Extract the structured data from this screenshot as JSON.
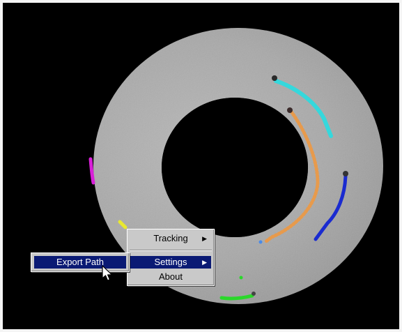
{
  "menu": {
    "tracking_label": "Tracking",
    "settings_label": "Settings",
    "about_label": "About",
    "submenu_arrow": "▶"
  },
  "submenu": {
    "export_path_label": "Export Path"
  },
  "colors": {
    "menu_bg": "#c9c9c9",
    "highlight": "#0a1a74",
    "track_cyan": "#35d8dc",
    "track_orange": "#e79a4c",
    "track_blue": "#1a2bd0",
    "track_magenta": "#d820d8",
    "track_yellow": "#e8e830",
    "track_green": "#2ad82a"
  }
}
